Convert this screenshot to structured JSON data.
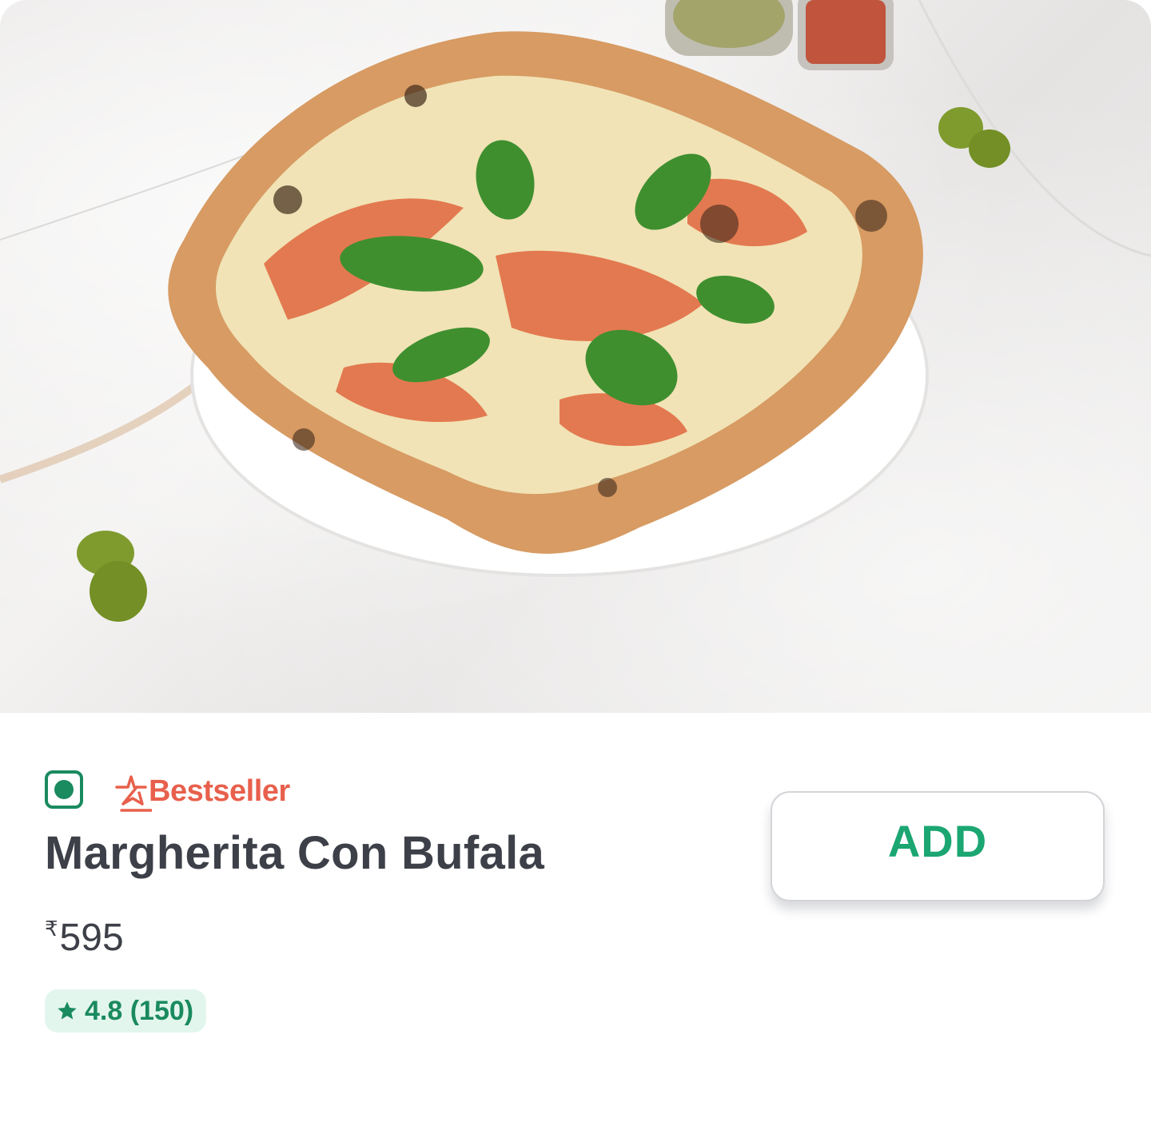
{
  "item": {
    "image_alt": "Margherita Con Bufala pizza",
    "is_veg": true,
    "badge_label": "Bestseller",
    "name": "Margherita Con Bufala",
    "currency_symbol": "₹",
    "price": "595",
    "rating": "4.8 (150)",
    "add_label": "ADD"
  },
  "colors": {
    "veg_green": "#1a8a5f",
    "bestseller_red": "#e8604c",
    "add_green": "#1ba672",
    "rating_bg": "#e3f6ee",
    "text_dark": "#3d4048"
  },
  "icons": {
    "veg": "veg-indicator-icon",
    "bestseller": "bestseller-star-icon",
    "rating": "star-icon"
  }
}
